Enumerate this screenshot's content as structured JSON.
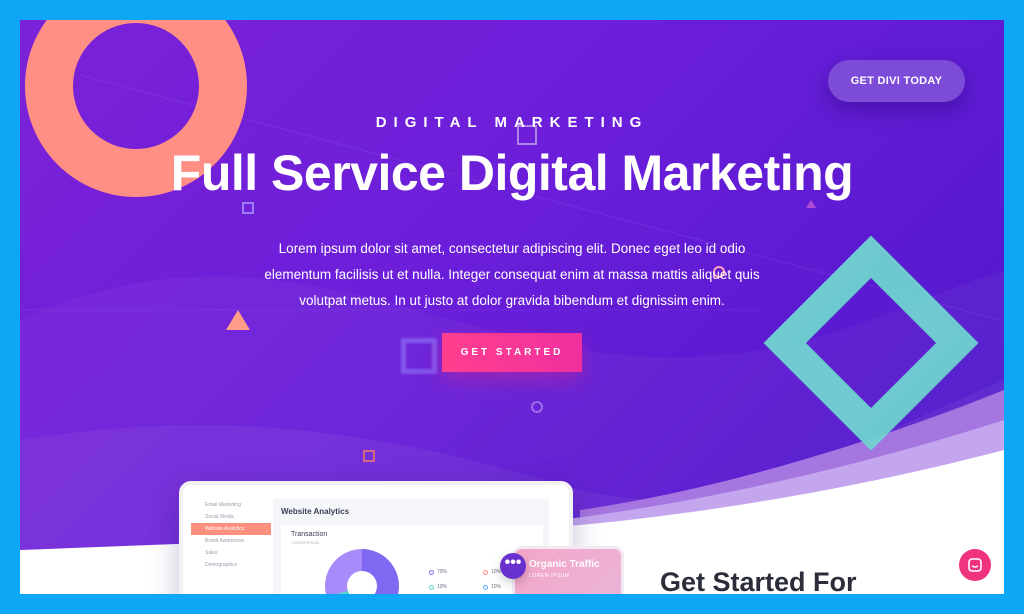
{
  "hero": {
    "eyebrow": "DIGITAL MARKETING",
    "title": "Full Service Digital Marketing",
    "body_lines": [
      "Lorem ipsum dolor sit amet, consectetur adipiscing elit. Donec eget leo id odio",
      "elementum facilisis ut et nulla. Integer consequat enim at massa mattis aliquet quis",
      "volutpat metus. In ut justo at dolor gravida bibendum et dignissim enim."
    ],
    "cta_label": "GET STARTED"
  },
  "header": {
    "cta_label": "GET DIVI TODAY"
  },
  "laptop": {
    "sidebar_items": [
      "Email Marketing",
      "Social Media",
      "Website Analytics",
      "Brand Awareness",
      "Sales",
      "Demographics"
    ],
    "active_item": "Website Analytics",
    "title": "Website Analytics",
    "card_title": "Transaction",
    "card_sub": "LOREM IPSUM",
    "legend": [
      {
        "value": "70%",
        "color": "#7f68f2"
      },
      {
        "value": "10%",
        "color": "#ff8f7e"
      },
      {
        "value": "10%",
        "color": "#5ad3c7"
      },
      {
        "value": "10%",
        "color": "#5aa9f5"
      }
    ]
  },
  "phone": {
    "title": "Organic Traffic",
    "subtitle": "LOREM IPSUM"
  },
  "section": {
    "title": "Get Started For"
  },
  "icons": {
    "more": "more-dots-icon",
    "chat": "chat-bubble-icon"
  },
  "colors": {
    "frame": "#0da7f5",
    "hero_start": "#7b22d8",
    "hero_end": "#4a16c8",
    "accent_pink": "#f0337f",
    "ring": "#ff8f84",
    "diamond": "#6fd3d0"
  }
}
